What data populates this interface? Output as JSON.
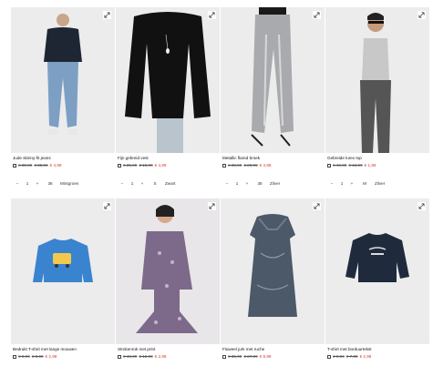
{
  "products": [
    {
      "name": "Jude skinny-fit jeans",
      "old_price": "€ 39,99",
      "old_price2": "€ 35,99",
      "price": "€ 4,99",
      "qty": "1",
      "size": "36",
      "color": "Mintgroen",
      "icon": "expand-icon"
    },
    {
      "name": "Fijn gebreid vest",
      "old_price": "€ 25,99",
      "old_price2": "€ 15,99",
      "price": "€ 4,99",
      "qty": "1",
      "size": "S",
      "color": "Zwart",
      "icon": "expand-icon"
    },
    {
      "name": "Metallic flared broek",
      "old_price": "€ 39,99",
      "old_price2": "€ 29,99",
      "price": "€ 4,99",
      "qty": "1",
      "size": "38",
      "color": "Zilver",
      "icon": "expand-icon"
    },
    {
      "name": "Gebreide lurex top",
      "old_price": "€ 19,99",
      "old_price2": "€ 12,99",
      "price": "€ 1,99",
      "qty": "1",
      "size": "M",
      "color": "Zilver",
      "icon": "expand-icon"
    },
    {
      "name": "Bedrukt T-shirt met lange mouwen",
      "old_price": "€ 9,99",
      "old_price2": "€ 5,99",
      "price": "€ 2,99",
      "qty": "",
      "size": "",
      "color": "",
      "icon": "expand-icon"
    },
    {
      "name": "Strokenrok met print",
      "old_price": "€ 19,99",
      "old_price2": "€ 12,99",
      "price": "€ 2,99",
      "qty": "",
      "size": "",
      "color": "",
      "icon": "expand-icon"
    },
    {
      "name": "Fluweel jurk met ruche",
      "old_price": "€ 35,99",
      "old_price2": "€ 27,99",
      "price": "€ 9,99",
      "qty": "",
      "size": "",
      "color": "",
      "icon": "expand-icon"
    },
    {
      "name": "T-shirt met borduurtekst",
      "old_price": "€ 9,99",
      "old_price2": "€ 7,99",
      "price": "€ 2,99",
      "qty": "",
      "size": "",
      "color": "",
      "icon": "expand-icon"
    }
  ],
  "colors": {
    "sale": "#d23b2e",
    "image_bg": "#f1f1f1"
  }
}
